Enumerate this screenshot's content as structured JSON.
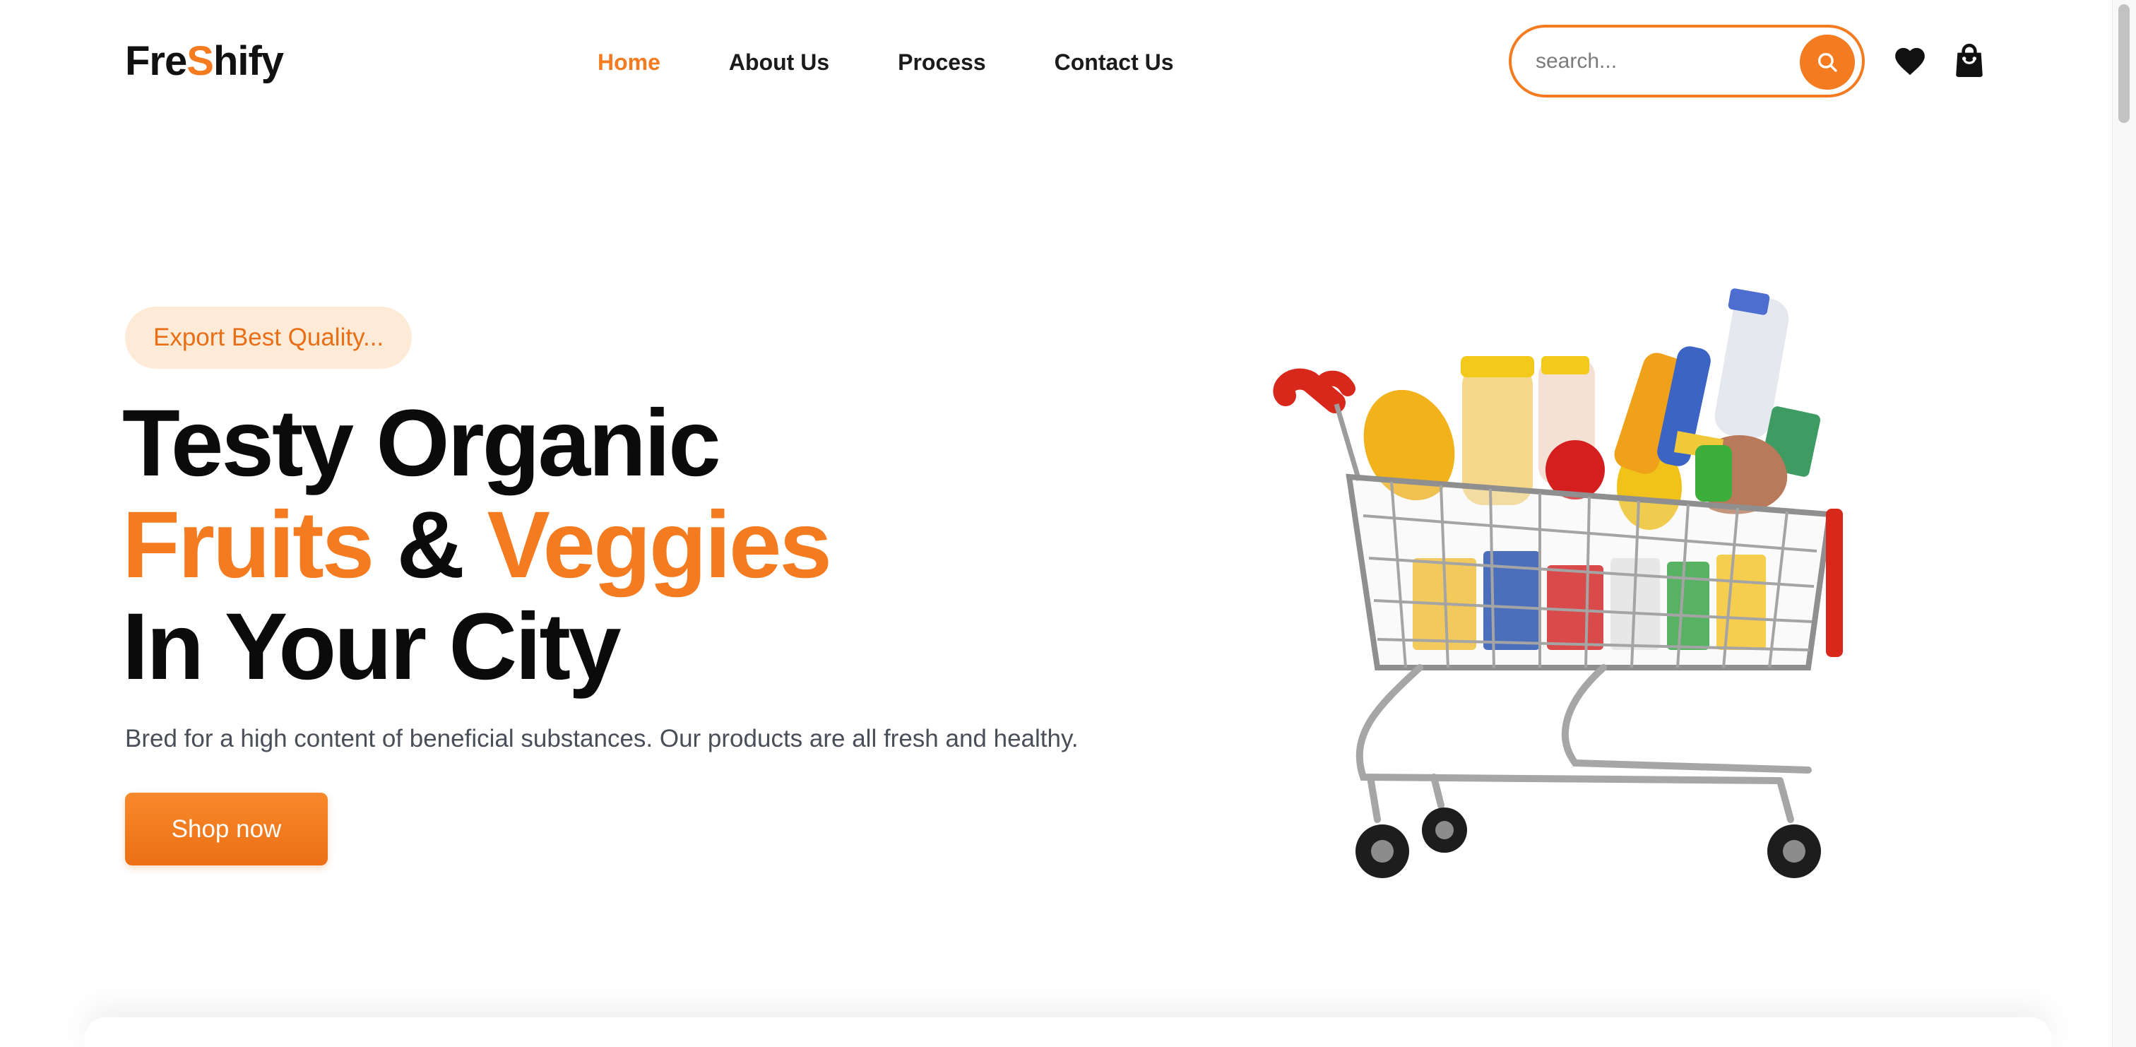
{
  "brand": {
    "logo_part1": "Fre",
    "logo_part2": "S",
    "logo_part3": "hify"
  },
  "nav": {
    "items": [
      {
        "label": "Home",
        "active": true
      },
      {
        "label": "About Us",
        "active": false
      },
      {
        "label": "Process",
        "active": false
      },
      {
        "label": "Contact Us",
        "active": false
      }
    ]
  },
  "search": {
    "placeholder": "search...",
    "value": ""
  },
  "header_icons": [
    "search-icon",
    "heart-icon",
    "shopping-bag-icon"
  ],
  "hero": {
    "badge": "Export Best Quality...",
    "headline_line1": "Testy Organic",
    "headline_word_fruits": "Fruits",
    "headline_amp": "&",
    "headline_word_veggies": "Veggies",
    "headline_line3": "In Your City",
    "subtitle": "Bred for a high content of beneficial substances. Our products are all fresh and healthy.",
    "cta_label": "Shop now"
  },
  "colors": {
    "accent": "#f47b20",
    "badge_bg": "#fdebd7",
    "text_dark": "#0b0b0b",
    "text_muted": "#4a4e58"
  }
}
